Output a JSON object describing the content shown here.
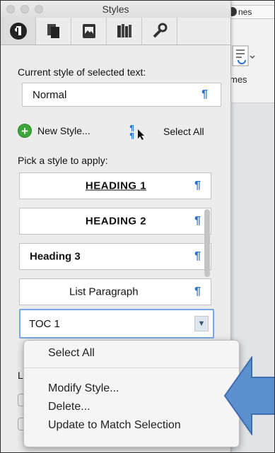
{
  "window": {
    "title": "Styles"
  },
  "background_app": {
    "tab_label": "nes",
    "styles_label": "mes"
  },
  "palette": {
    "tabs": [
      {
        "icon": "formatting-icon"
      },
      {
        "icon": "pages-icon"
      },
      {
        "icon": "media-browser-icon"
      },
      {
        "icon": "library-icon"
      },
      {
        "icon": "tools-icon"
      }
    ],
    "current_style_label": "Current style of selected text:",
    "current_style_value": "Normal",
    "new_style_label": "New Style...",
    "select_all_label": "Select All",
    "pick_label": "Pick a style to apply:",
    "styles": [
      {
        "label": "HEADING 1"
      },
      {
        "label": "HEADING 2"
      },
      {
        "label": "Heading 3"
      },
      {
        "label": "List Paragraph"
      },
      {
        "label": "TOC 1"
      }
    ],
    "partial_label_below": "L",
    "pilcrow": "¶"
  },
  "context_menu": {
    "items": [
      {
        "label": "Select All"
      },
      {
        "label": "Modify Style..."
      },
      {
        "label": "Delete..."
      },
      {
        "label": "Update to Match Selection"
      }
    ]
  },
  "colors": {
    "accent_blue": "#2a6fd6",
    "arrow_blue": "#5b8fd0",
    "add_green": "#3ca63c"
  }
}
